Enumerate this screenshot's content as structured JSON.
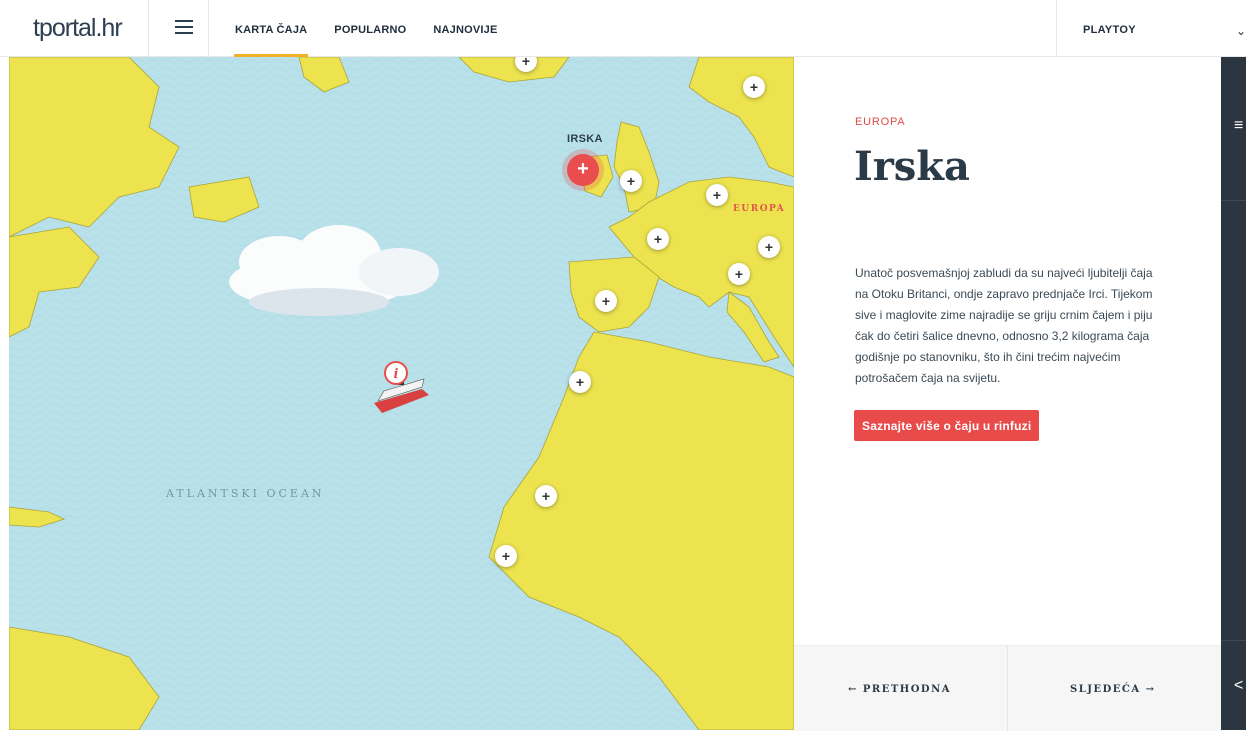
{
  "header": {
    "logo_main": "tportal",
    "logo_suffix": ".hr",
    "nav": [
      {
        "label": "KARTA ČAJA",
        "active": true
      },
      {
        "label": "POPULARNO",
        "active": false
      },
      {
        "label": "NAJNOVIJE",
        "active": false
      }
    ],
    "account_label": "PLAYTOY",
    "chevron_icon": "chevron-down-icon"
  },
  "map": {
    "selected_label": "IRSKA",
    "region_label": "EUROPA",
    "ocean_label": "ATLANTSKI OCEAN",
    "marker_symbol": "+",
    "info_symbol": "i",
    "colors": {
      "ocean": "#b9e1ea",
      "land": "#ece34f",
      "accent": "#e94d4d"
    }
  },
  "panel": {
    "region": "EUROPA",
    "title": "Irska",
    "description": "Unatoč posvemašnjoj zabludi da su najveći ljubitelji čaja na Otoku Britanci, ondje zapravo prednjače Irci. Tijekom sive i maglovite zime najradije se griju crnim čajem i piju čak do četiri šalice dnevno, odnosno 3,2 kilograma čaja godišnje po stanovniku, što ih čini trećim najvećim potrošačem čaja na svijetu.",
    "cta": "Saznajte više o čaju u rinfuzi",
    "prev": "← PRETHODNA",
    "next": "SLJEDEĆA →"
  },
  "rail": {
    "menu_icon": "≡",
    "share_icon": "<"
  }
}
